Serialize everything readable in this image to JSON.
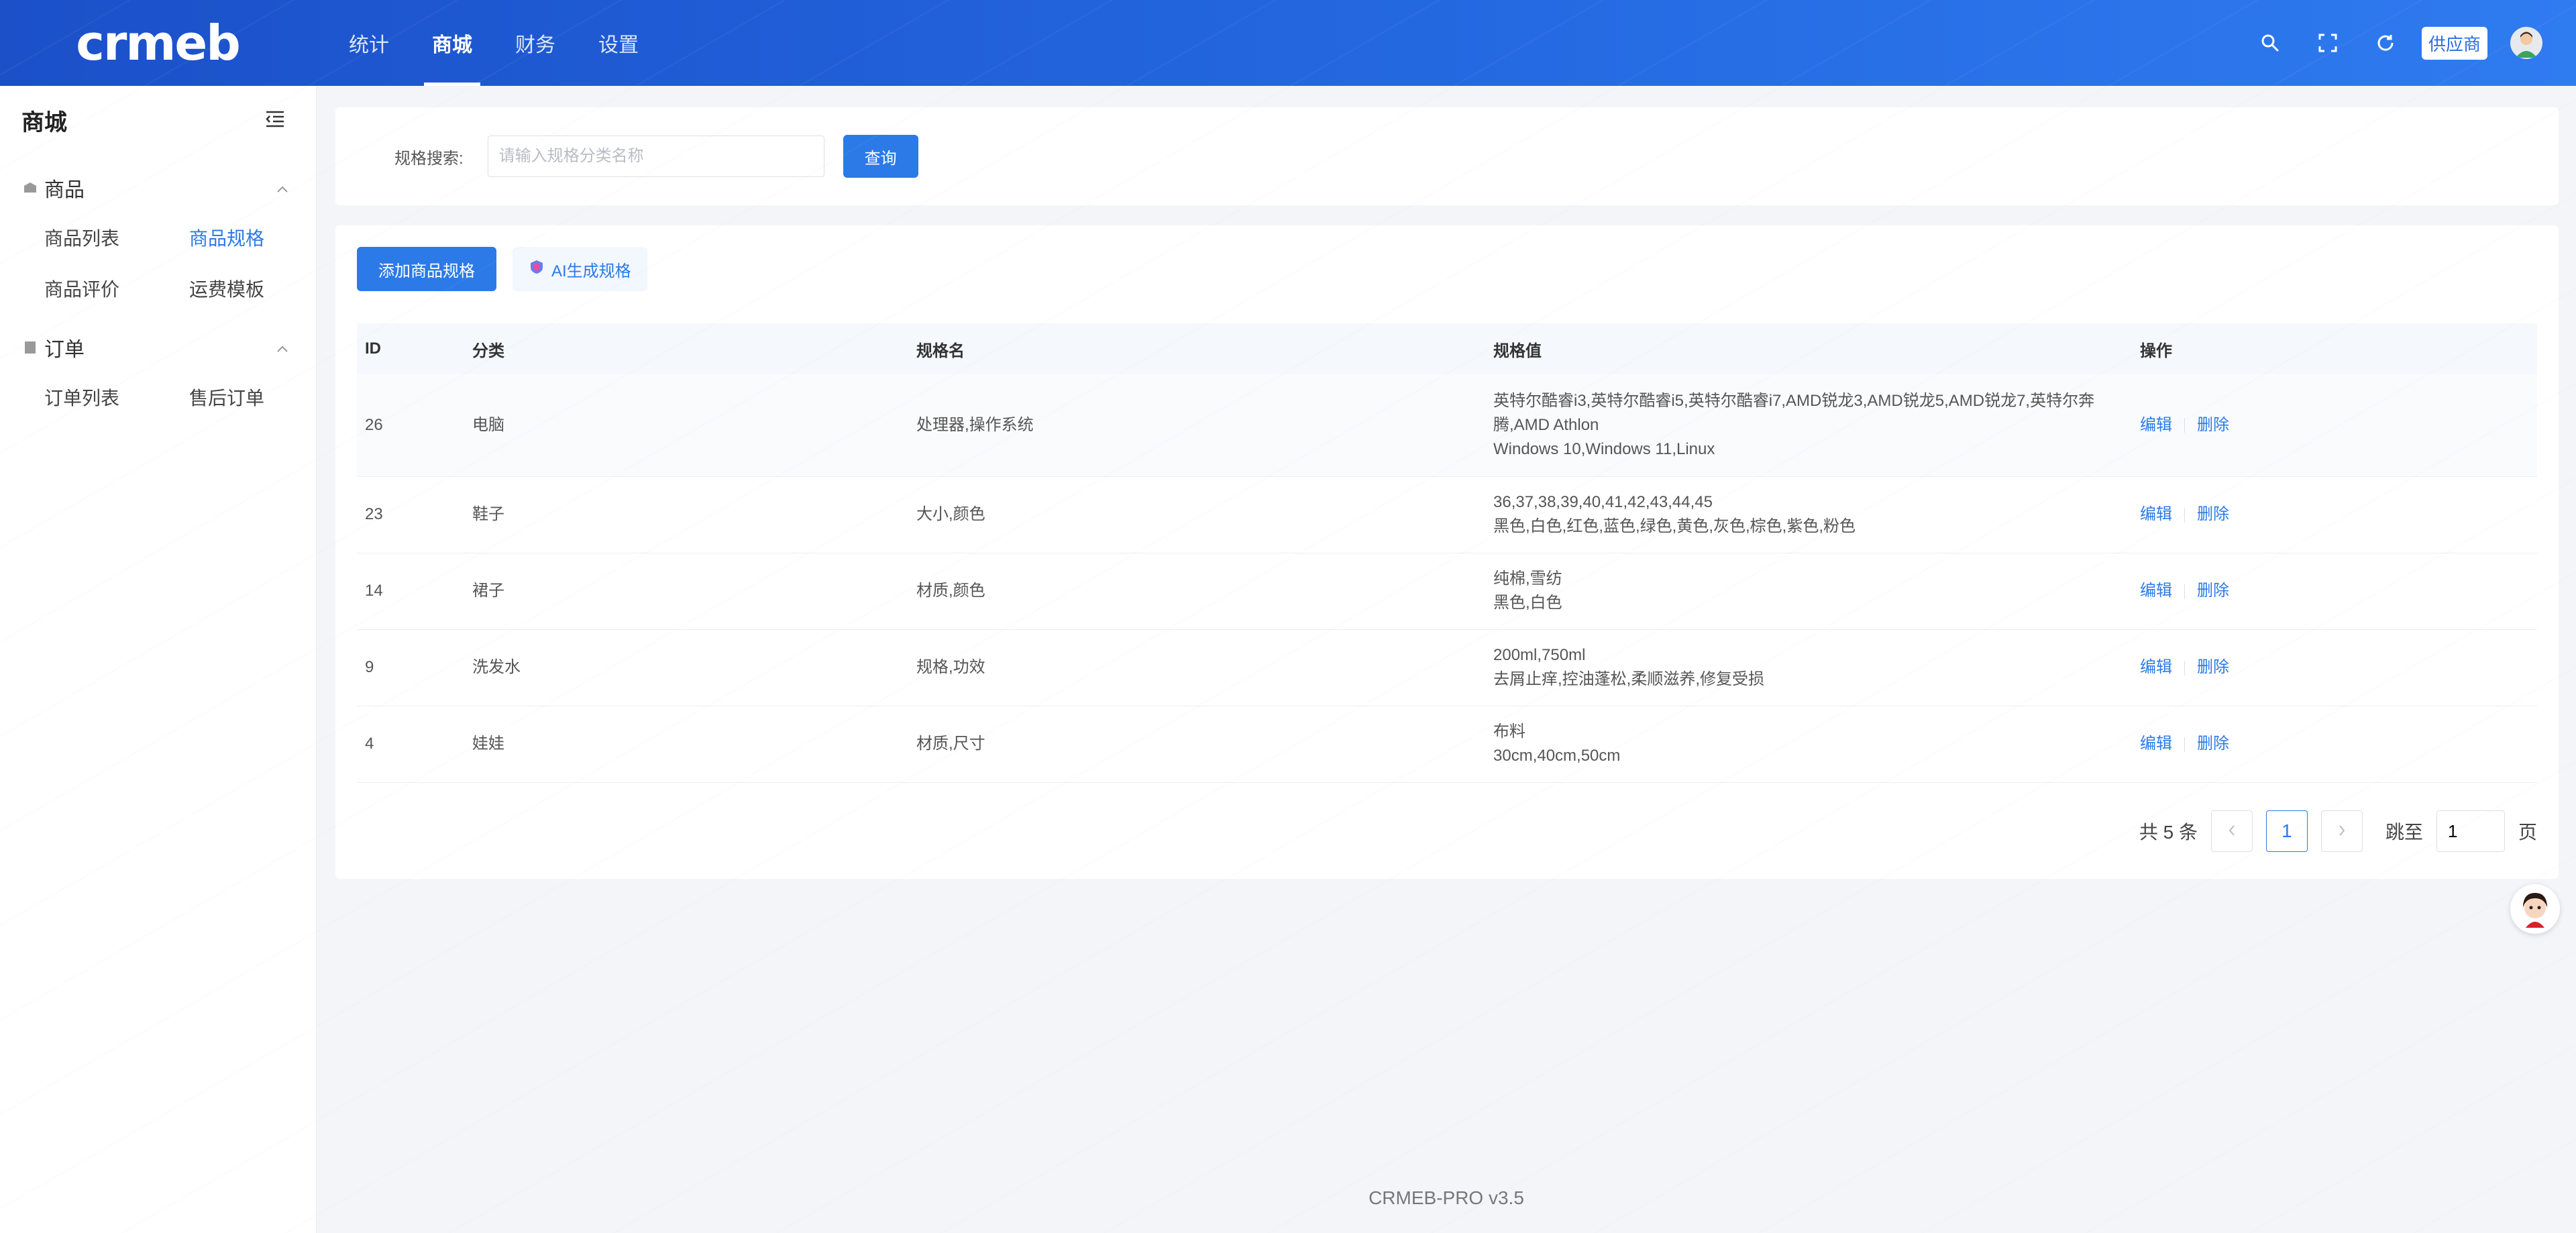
{
  "header": {
    "logo": "crmeb",
    "nav": [
      {
        "label": "统计"
      },
      {
        "label": "商城"
      },
      {
        "label": "财务"
      },
      {
        "label": "设置"
      }
    ],
    "supplier_badge": "供应商",
    "icons": [
      "search-icon",
      "fullscreen-icon",
      "refresh-icon"
    ]
  },
  "sidebar": {
    "title": "商城",
    "groups": [
      {
        "label": "商品",
        "icon": "goods-icon",
        "items": [
          {
            "label": "商品列表"
          },
          {
            "label": "商品规格"
          },
          {
            "label": "商品评价"
          },
          {
            "label": "运费模板"
          }
        ]
      },
      {
        "label": "订单",
        "icon": "order-icon",
        "items": [
          {
            "label": "订单列表"
          },
          {
            "label": "售后订单"
          }
        ]
      }
    ]
  },
  "search": {
    "label": "规格搜索:",
    "placeholder": "请输入规格分类名称",
    "button": "查询"
  },
  "toolbar": {
    "add_button": "添加商品规格",
    "ai_button": "AI生成规格"
  },
  "table": {
    "headers": {
      "id": "ID",
      "category": "分类",
      "name": "规格名",
      "values": "规格值",
      "actions": "操作"
    },
    "rows": [
      {
        "id": "26",
        "category": "电脑",
        "name": "处理器,操作系统",
        "values": [
          "英特尔酷睿i3,英特尔酷睿i5,英特尔酷睿i7,AMD锐龙3,AMD锐龙5,AMD锐龙7,英特尔奔腾,AMD Athlon",
          "Windows 10,Windows 11,Linux"
        ]
      },
      {
        "id": "23",
        "category": "鞋子",
        "name": "大小,颜色",
        "values": [
          "36,37,38,39,40,41,42,43,44,45",
          "黑色,白色,红色,蓝色,绿色,黄色,灰色,棕色,紫色,粉色"
        ]
      },
      {
        "id": "14",
        "category": "裙子",
        "name": "材质,颜色",
        "values": [
          "纯棉,雪纺",
          "黑色,白色"
        ]
      },
      {
        "id": "9",
        "category": "洗发水",
        "name": "规格,功效",
        "values": [
          "200ml,750ml",
          "去屑止痒,控油蓬松,柔顺滋养,修复受损"
        ]
      },
      {
        "id": "4",
        "category": "娃娃",
        "name": "材质,尺寸",
        "values": [
          "布料",
          "30cm,40cm,50cm"
        ]
      }
    ],
    "action_edit": "编辑",
    "action_delete": "删除"
  },
  "pagination": {
    "total": "共 5 条",
    "current": "1",
    "jump_label": "跳至",
    "jump_value": "1",
    "page_suffix": "页"
  },
  "footer": "CRMEB-PRO v3.5",
  "colors": {
    "primary": "#2b7ae8",
    "header_start": "#1b50c9",
    "header_end": "#2f7bf0"
  }
}
